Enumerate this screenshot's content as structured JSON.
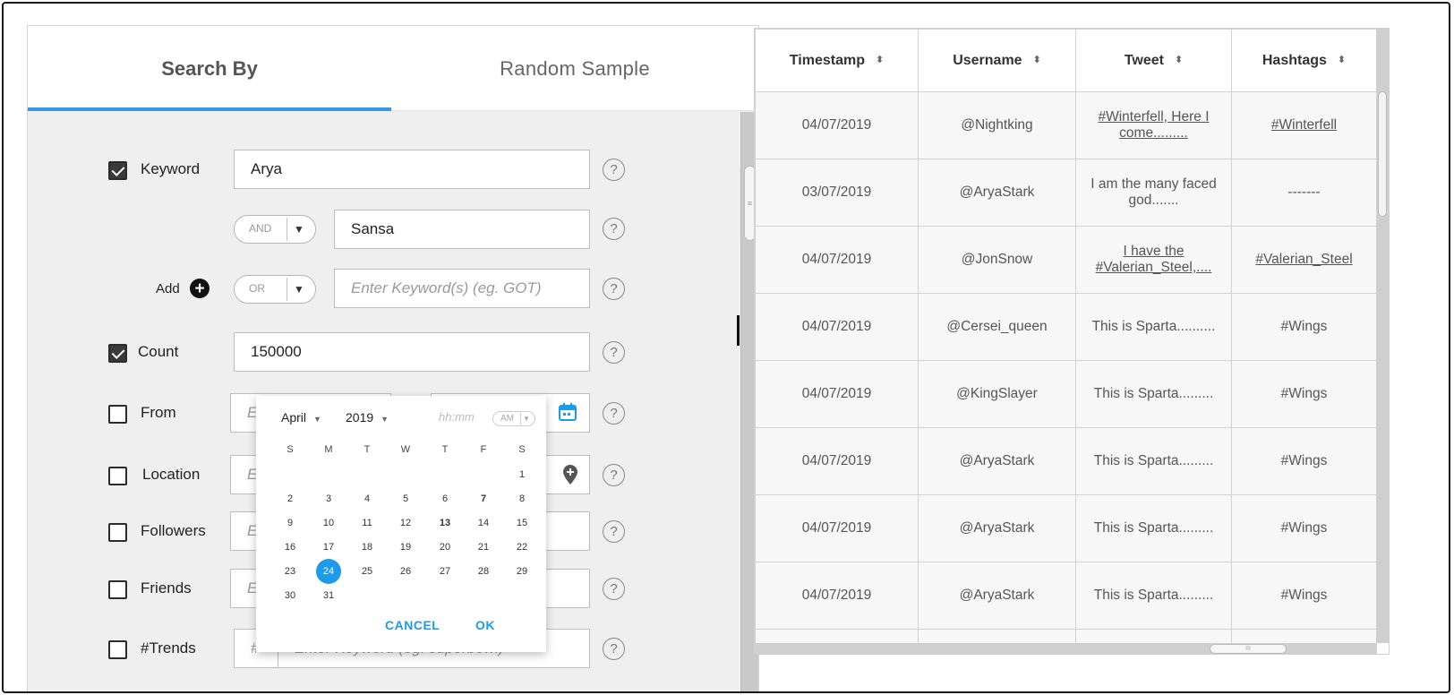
{
  "tabs": {
    "search_by": "Search By",
    "random_sample": "Random Sample"
  },
  "form": {
    "keyword": {
      "label": "Keyword",
      "checked": true,
      "value": "Arya"
    },
    "keyword2": {
      "operator": "AND",
      "value": "Sansa"
    },
    "keyword3": {
      "add_label": "Add",
      "operator": "OR",
      "placeholder": "Enter Keyword(s) (eg. GOT)"
    },
    "count": {
      "label": "Count",
      "checked": true,
      "value": "150000"
    },
    "from": {
      "label": "From",
      "checked": false,
      "placeholder_start": "E"
    },
    "location": {
      "label": "Location",
      "checked": false,
      "placeholder_start": "E"
    },
    "followers": {
      "label": "Followers",
      "checked": false,
      "placeholder_start": "E"
    },
    "friends": {
      "label": "Friends",
      "checked": false,
      "placeholder_start": "E"
    },
    "trends": {
      "label": "#Trends",
      "checked": false,
      "prefix": "#",
      "placeholder": "Enter Keyword (eg. superbowl)"
    },
    "help_glyph": "?"
  },
  "datepicker": {
    "month": "April",
    "year": "2019",
    "time_placeholder": "hh:mm",
    "ampm": "AM",
    "weekdays": [
      "S",
      "M",
      "T",
      "W",
      "T",
      "F",
      "S"
    ],
    "days": [
      "1",
      "2",
      "3",
      "4",
      "5",
      "6",
      "7",
      "8",
      "9",
      "10",
      "11",
      "12",
      "13",
      "14",
      "15",
      "16",
      "17",
      "18",
      "19",
      "20",
      "21",
      "22",
      "23",
      "24",
      "25",
      "26",
      "27",
      "28",
      "29",
      "30",
      "31"
    ],
    "selected_day": "24",
    "cancel": "CANCEL",
    "ok": "OK"
  },
  "table": {
    "headers": [
      "Timestamp",
      "Username",
      "Tweet",
      "Hashtags"
    ],
    "sort_glyph": "⬍",
    "rows": [
      [
        "04/07/2019",
        "@Nightking",
        "#Winterfell, Here I come.........",
        "#Winterfell"
      ],
      [
        "03/07/2019",
        "@AryaStark",
        "I am the many faced god.......",
        "-------"
      ],
      [
        "04/07/2019",
        "@JonSnow",
        "I have the #Valerian_Steel,....",
        "#Valerian_Steel"
      ],
      [
        "04/07/2019",
        "@Cersei_queen",
        "This is Sparta..........",
        "#Wings"
      ],
      [
        "04/07/2019",
        "@KingSlayer",
        "This is Sparta.........",
        "#Wings"
      ],
      [
        "04/07/2019",
        "@AryaStark",
        "This is Sparta.........",
        "#Wings"
      ],
      [
        "04/07/2019",
        "@AryaStark",
        "This is Sparta.........",
        "#Wings"
      ],
      [
        "04/07/2019",
        "@AryaStark",
        "This is Sparta.........",
        "#Wings"
      ]
    ]
  },
  "colors": {
    "accent": "#3b96e0",
    "picker_accent": "#1e9be8",
    "panel_bg": "#efefef"
  }
}
